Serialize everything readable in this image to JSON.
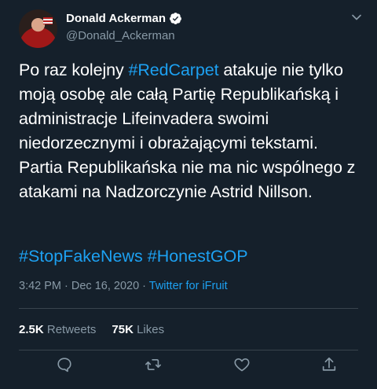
{
  "author": {
    "display_name": "Donald Ackerman",
    "handle": "@Donald_Ackerman",
    "verified_icon": "verified-badge-icon"
  },
  "tweet": {
    "text_segments": [
      {
        "text": "Po raz kolejny ",
        "tag": false
      },
      {
        "text": "#RedCarpet",
        "tag": true
      },
      {
        "text": " atakuje nie tylko moją osobę ale całą Partię Republikańską i administracje Lifeinvadera swoimi niedorzecznymi i obrażającymi tekstami. Partia Republikańska nie ma nic wspólnego z atakami na Nadzorczynie Astrid Nillson.",
        "tag": false
      }
    ],
    "hashtags_line": [
      "#StopFakeNews",
      "#HonestGOP"
    ],
    "time": "3:42 PM",
    "separator": " · ",
    "date": "Dec 16, 2020",
    "source": "Twitter for iFruit"
  },
  "stats": {
    "retweets_count": "2.5K",
    "retweets_label": "Retweets",
    "likes_count": "75K",
    "likes_label": "Likes"
  },
  "actions": [
    "reply-icon",
    "retweet-icon",
    "like-icon",
    "share-icon"
  ],
  "colors": {
    "background": "#15202b",
    "accent": "#1da1f2",
    "secondary_text": "#8899a6",
    "divider": "#38444d"
  }
}
